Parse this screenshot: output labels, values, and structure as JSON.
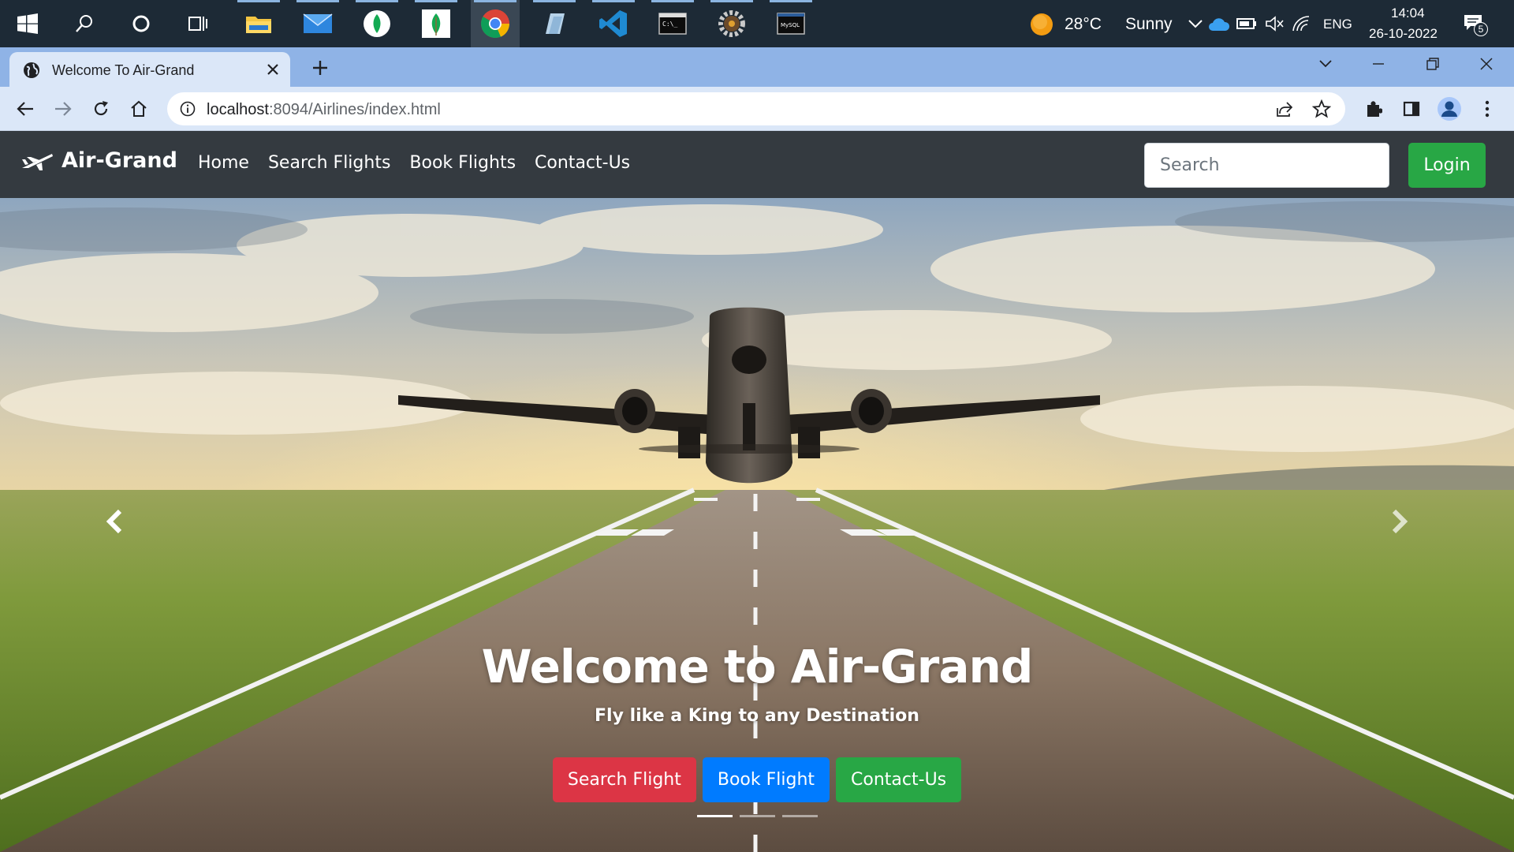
{
  "taskbar": {
    "apps": [
      {
        "name": "windows-start"
      },
      {
        "name": "search"
      },
      {
        "name": "cortana"
      },
      {
        "name": "task-view"
      },
      {
        "name": "file-explorer"
      },
      {
        "name": "mail"
      },
      {
        "name": "mongodb-compass"
      },
      {
        "name": "mongodb"
      },
      {
        "name": "chrome"
      },
      {
        "name": "app-blue"
      },
      {
        "name": "vscode"
      },
      {
        "name": "terminal"
      },
      {
        "name": "settings-app"
      },
      {
        "name": "mysql"
      }
    ],
    "weather": {
      "temp": "28°C",
      "condition": "Sunny"
    },
    "language": "ENG",
    "time": "14:04",
    "date": "26-10-2022",
    "notification_count": "5"
  },
  "browser": {
    "tab_title": "Welcome To Air-Grand",
    "url_host": "localhost",
    "url_rest": ":8094/Airlines/index.html"
  },
  "site": {
    "brand": "Air-Grand",
    "nav": [
      "Home",
      "Search Flights",
      "Book Flights",
      "Contact-Us"
    ],
    "search_placeholder": "Search",
    "login_label": "Login"
  },
  "hero": {
    "title": "Welcome to Air-Grand",
    "subtitle": "Fly like a King to any Destination",
    "buttons": [
      "Search Flight",
      "Book Flight",
      "Contact-Us"
    ],
    "slide_count": 3,
    "active_slide": 1
  },
  "colors": {
    "navbar_bg": "#343a40",
    "success": "#28a745",
    "danger": "#dc3545",
    "primary": "#007bff",
    "taskbar_bg": "#1d2a36",
    "tabstrip_bg": "#8fb3e6"
  }
}
